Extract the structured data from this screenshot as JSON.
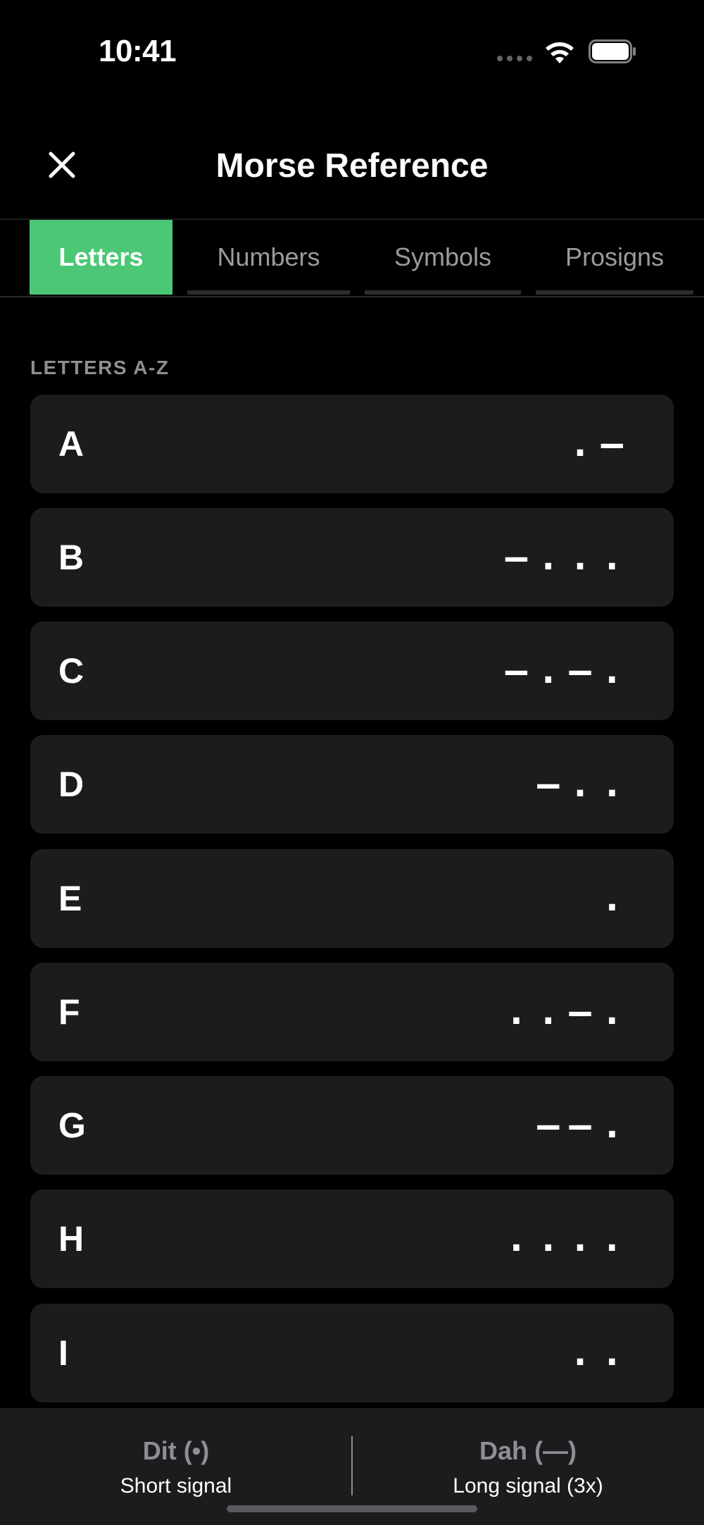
{
  "status": {
    "time": "10:41"
  },
  "nav": {
    "title": "Morse Reference",
    "close_icon": "close-icon"
  },
  "tabs": [
    {
      "label": "Letters",
      "active": true
    },
    {
      "label": "Numbers",
      "active": false
    },
    {
      "label": "Symbols",
      "active": false
    },
    {
      "label": "Prosigns",
      "active": false
    }
  ],
  "section": {
    "header": "LETTERS A-Z"
  },
  "letters": [
    {
      "char": "A",
      "code": ".–"
    },
    {
      "char": "B",
      "code": "–..."
    },
    {
      "char": "C",
      "code": "–.–."
    },
    {
      "char": "D",
      "code": "–.."
    },
    {
      "char": "E",
      "code": "."
    },
    {
      "char": "F",
      "code": "..–."
    },
    {
      "char": "G",
      "code": "––."
    },
    {
      "char": "H",
      "code": "...."
    },
    {
      "char": "I",
      "code": ".."
    }
  ],
  "legend": {
    "dit": {
      "title": "Dit (•)",
      "subtitle": "Short signal"
    },
    "dah": {
      "title": "Dah (—)",
      "subtitle": "Long signal (3x)"
    }
  },
  "colors": {
    "accent": "#4cc775",
    "row_bg": "#1c1c1e",
    "muted": "#8e8e93"
  }
}
